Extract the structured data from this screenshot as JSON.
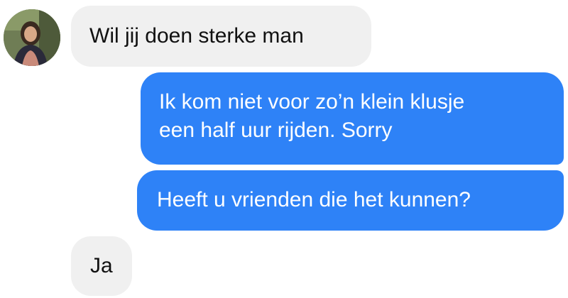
{
  "conversation": {
    "contact_avatar": "contact-avatar-photo",
    "messages": [
      {
        "direction": "incoming",
        "text": "Wil jij doen sterke man"
      },
      {
        "direction": "outgoing",
        "lines": [
          "Ik kom niet voor zo’n klein klusje",
          "een half uur rijden. Sorry"
        ]
      },
      {
        "direction": "outgoing",
        "text": "Heeft u vrienden die het kunnen?"
      },
      {
        "direction": "incoming",
        "text": "Ja"
      }
    ]
  },
  "colors": {
    "outgoing_bubble": "#2e82f7",
    "incoming_bubble": "#f0f0f0",
    "outgoing_text": "#ffffff",
    "incoming_text": "#111111"
  }
}
